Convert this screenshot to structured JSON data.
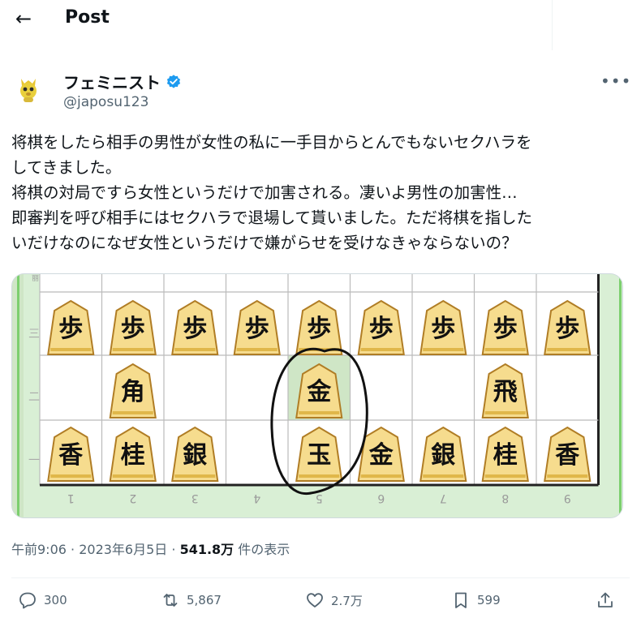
{
  "header": {
    "title": "Post",
    "back_icon": "arrow-left-icon"
  },
  "author": {
    "display_name": "フェミニスト",
    "handle": "@japosu123",
    "verified_color": "#1d9bf0",
    "avatar_icon": "cartoon-avatar-icon"
  },
  "post": {
    "text": "将棋をしたら相手の男性が女性の私に一手目からとんでもないセクハラを\nしてきました。\n将棋の対局ですら女性というだけで加害される。凄いよ男性の加害性…\n即審判を呼び相手にはセクハラで退場して貰いました。ただ将棋を指した\nいだけなのになぜ女性というだけで嫌がらせを受けなきゃならないの？"
  },
  "board": {
    "ranks": {
      "top_row": [
        "歩",
        "歩",
        "歩",
        "歩",
        "歩",
        "歩",
        "歩",
        "歩",
        "歩"
      ],
      "middle_row": [
        "",
        "角",
        "",
        "",
        "金",
        "",
        "",
        "飛",
        ""
      ],
      "bottom_row": [
        "香",
        "桂",
        "銀",
        "",
        "玉",
        "金",
        "銀",
        "桂",
        "香"
      ]
    },
    "file_labels": [
      "1",
      "2",
      "3",
      "4",
      "5",
      "6",
      "7",
      "8",
      "9"
    ],
    "highlight_color": "#cfe6c6"
  },
  "meta": {
    "time": "午前9:06",
    "date": "2023年6月5日",
    "views": "541.8万",
    "views_label": "件の表示"
  },
  "actions": {
    "replies": "300",
    "reposts": "5,867",
    "likes": "2.7万",
    "bookmarks": "599"
  }
}
